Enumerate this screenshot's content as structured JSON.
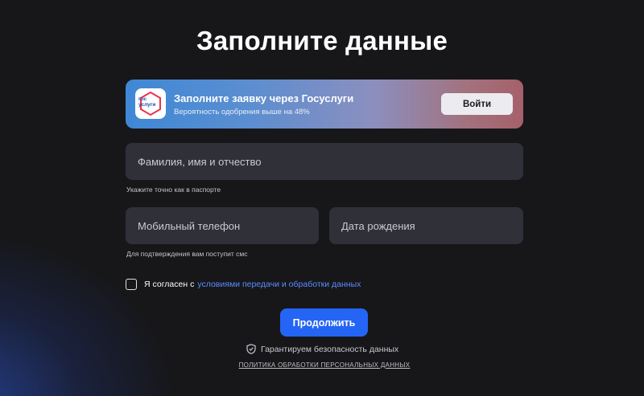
{
  "page": {
    "title": "Заполните данные"
  },
  "gosuslugi": {
    "logo_text_line1": "гос",
    "logo_text_line2": "услуги",
    "title": "Заполните заявку через Госуслуги",
    "subtitle": "Вероятность одобрения выше на 48%",
    "login_label": "Войти"
  },
  "form": {
    "fio_placeholder": "Фамилия, имя и отчество",
    "fio_value": "",
    "fio_hint": "Укажите точно как в паспорте",
    "phone_placeholder": "Мобильный телефон",
    "phone_value": "",
    "phone_hint": "Для подтверждения вам поступит смс",
    "birth_placeholder": "Дата рождения",
    "birth_value": ""
  },
  "consent": {
    "checked": false,
    "text": "Я согласен с",
    "link_text": "условиями передачи и обработки данных"
  },
  "actions": {
    "continue_label": "Продолжить",
    "guarantee_text": "Гарантируем безопасность данных",
    "guarantee_icon": "shield-check-icon",
    "policy_link": "ПОЛИТИКА ОБРАБОТКИ ПЕРСОНАЛЬНЫХ ДАННЫХ"
  },
  "colors": {
    "background": "#17171a",
    "field": "#303039",
    "accent": "#2465f5",
    "link": "#5b8cff"
  }
}
